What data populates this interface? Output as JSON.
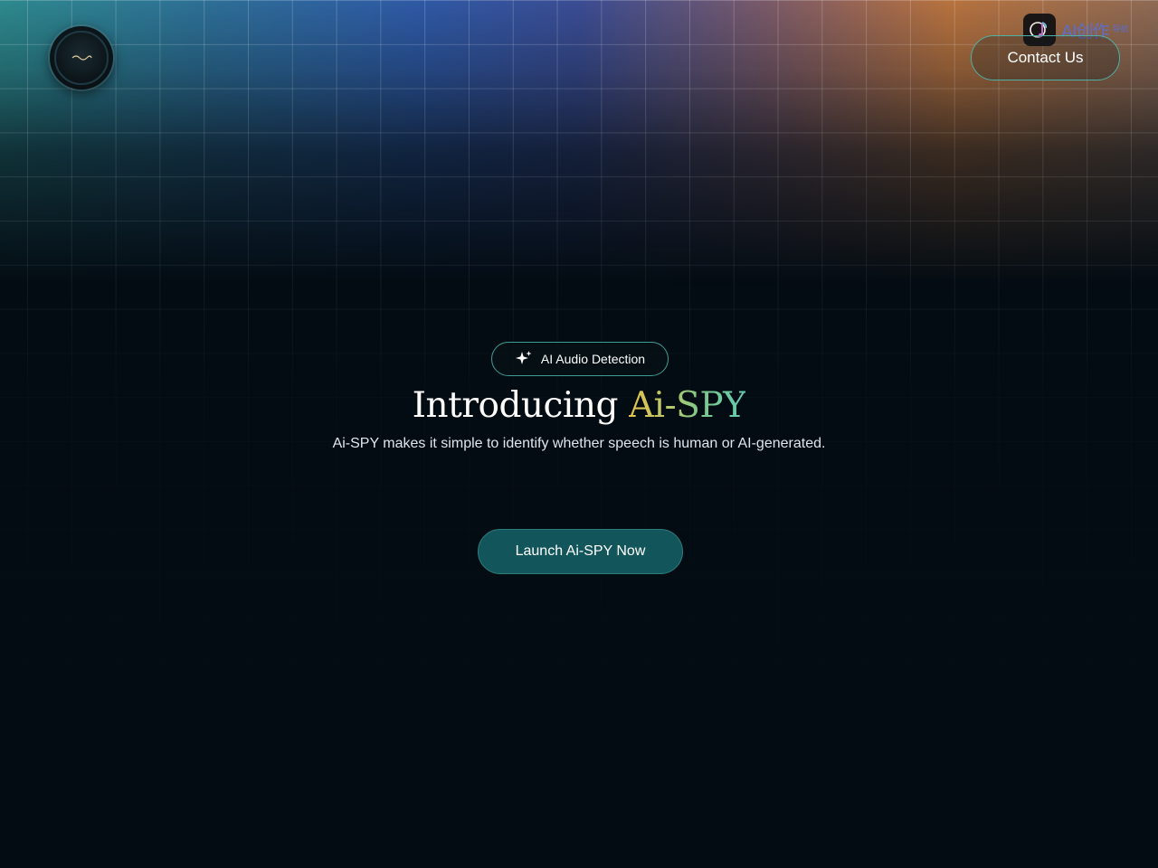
{
  "header": {
    "logo_icon": "audio-waveform-icon",
    "contact_label": "Contact Us",
    "watermark": {
      "icon": "music-note-logo-icon",
      "text": "AI创作",
      "subtext": "导航"
    }
  },
  "hero": {
    "badge": {
      "icon": "sparkle-icon",
      "label": "AI Audio Detection"
    },
    "headline_prefix": "Introducing",
    "headline_brand": "Ai-SPY",
    "description": "Ai-SPY makes it simple to identify whether speech is human or AI-generated.",
    "cta_label": "Launch Ai-SPY Now"
  },
  "colors": {
    "background": "#040c13",
    "accent_teal": "#12555a",
    "brand_gradient_start": "#e4c24a",
    "brand_gradient_end": "#63c9b0"
  }
}
